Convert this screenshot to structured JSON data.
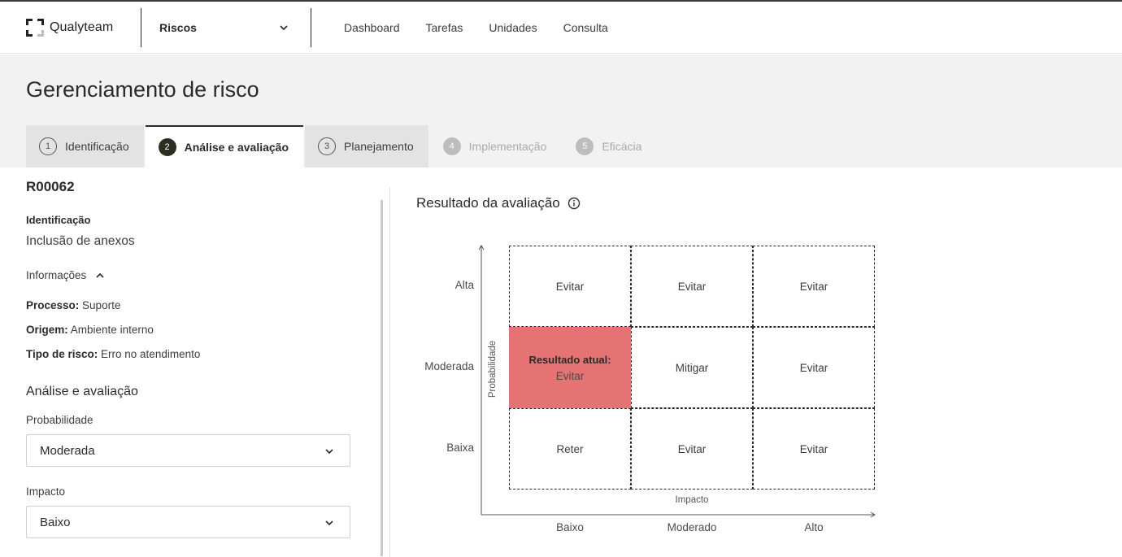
{
  "header": {
    "brand": "Qualyteam",
    "module": "Riscos",
    "nav": [
      "Dashboard",
      "Tarefas",
      "Unidades",
      "Consulta"
    ]
  },
  "page": {
    "title": "Gerenciamento de risco",
    "steps": [
      {
        "number": "1",
        "label": "Identificação",
        "state": "done"
      },
      {
        "number": "2",
        "label": "Análise e avaliação",
        "state": "active"
      },
      {
        "number": "3",
        "label": "Planejamento",
        "state": "done"
      },
      {
        "number": "4",
        "label": "Implementação",
        "state": "disabled"
      },
      {
        "number": "5",
        "label": "Eficácia",
        "state": "disabled"
      }
    ]
  },
  "risk": {
    "code": "R00062",
    "identification_label": "Identificação",
    "identification_value": "Inclusão de anexos",
    "info_toggle": "Informações",
    "process_label": "Processo:",
    "process_value": "Suporte",
    "origin_label": "Origem:",
    "origin_value": "Ambiente interno",
    "type_label": "Tipo de risco:",
    "type_value": "Erro no atendimento"
  },
  "analysis": {
    "section_title": "Análise e avaliação",
    "probability_label": "Probabilidade",
    "probability_value": "Moderada",
    "impact_label": "Impacto",
    "impact_value": "Baixo"
  },
  "result": {
    "title": "Resultado da avaliação",
    "y_axis_title": "Probabilidade",
    "x_axis_title": "Impacto",
    "y_labels": [
      "Alta",
      "Moderada",
      "Baixa"
    ],
    "x_labels": [
      "Baixo",
      "Moderado",
      "Alto"
    ],
    "current_label": "Resultado atual:",
    "cells": [
      [
        "Evitar",
        "Evitar",
        "Evitar"
      ],
      [
        "Evitar",
        "Mitigar",
        "Evitar"
      ],
      [
        "Reter",
        "Evitar",
        "Evitar"
      ]
    ],
    "current_cell": {
      "row": 1,
      "col": 0
    },
    "current_color": "#e57373"
  }
}
